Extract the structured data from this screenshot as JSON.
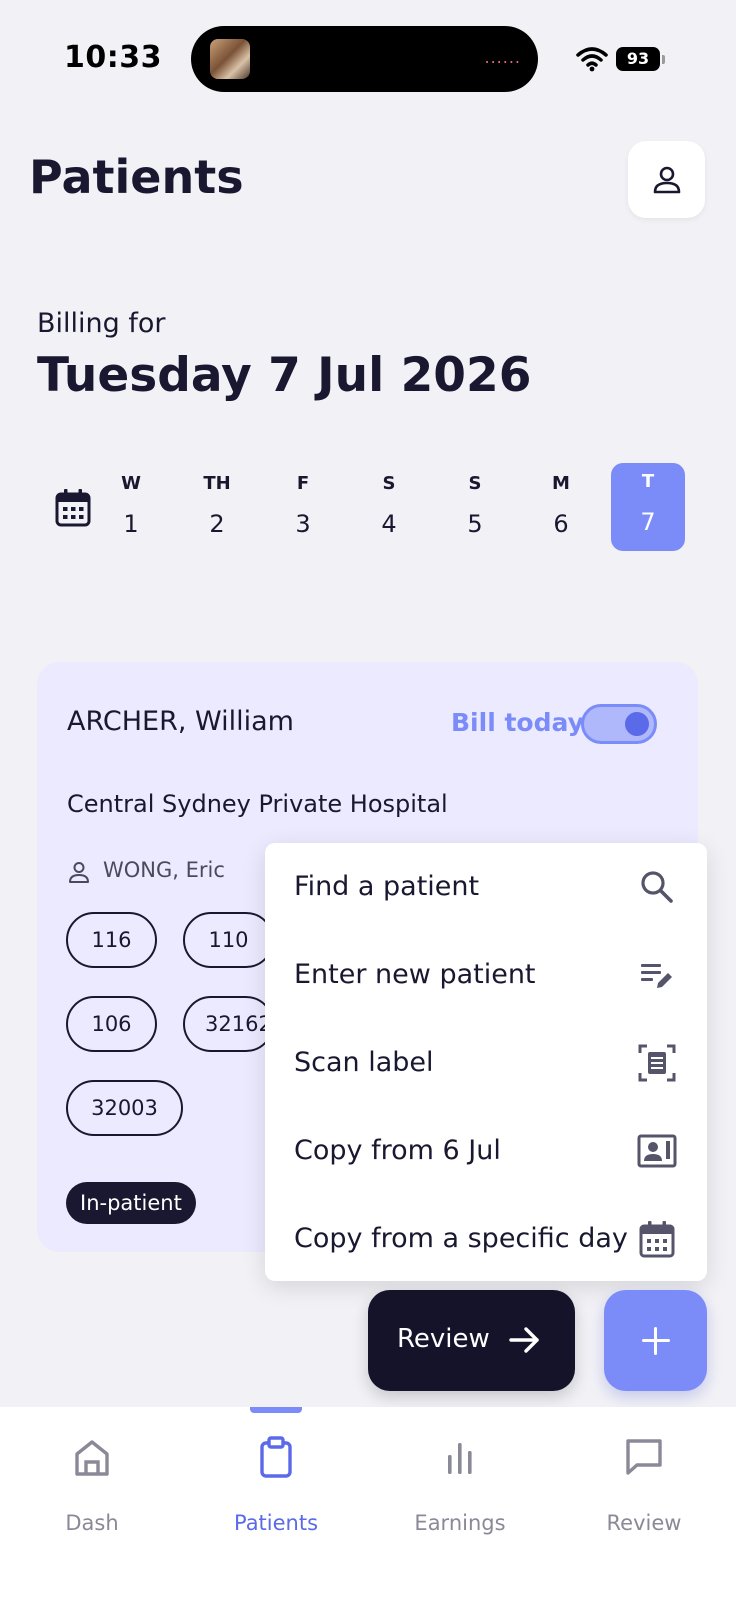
{
  "status_bar": {
    "time": "10:33",
    "battery": "93",
    "activity_dots": "......"
  },
  "header": {
    "title": "Patients",
    "profile_icon": "person-icon"
  },
  "billing": {
    "label": "Billing for",
    "date": "Tuesday 7 Jul 2026"
  },
  "day_strip": {
    "calendar_icon": "calendar-icon",
    "days": [
      {
        "dow": "W",
        "num": "1",
        "selected": false
      },
      {
        "dow": "TH",
        "num": "2",
        "selected": false
      },
      {
        "dow": "F",
        "num": "3",
        "selected": false
      },
      {
        "dow": "S",
        "num": "4",
        "selected": false
      },
      {
        "dow": "S",
        "num": "5",
        "selected": false
      },
      {
        "dow": "M",
        "num": "6",
        "selected": false
      },
      {
        "dow": "T",
        "num": "7",
        "selected": true
      }
    ]
  },
  "patient_card": {
    "name": "ARCHER, William",
    "bill_today_label": "Bill today",
    "bill_today_on": true,
    "hospital": "Central Sydney Private Hospital",
    "doctor": "WONG, Eric",
    "codes": [
      "116",
      "110",
      "106",
      "32162",
      "32003"
    ],
    "admission_type": "In-patient"
  },
  "menu": {
    "items": [
      {
        "label": "Find a patient",
        "icon": "search-icon"
      },
      {
        "label": "Enter new patient",
        "icon": "edit-list-icon"
      },
      {
        "label": "Scan label",
        "icon": "scan-document-icon"
      },
      {
        "label": "Copy from 6 Jul",
        "icon": "contact-card-icon"
      },
      {
        "label": "Copy from a specific day",
        "icon": "calendar-icon"
      }
    ]
  },
  "actions": {
    "review_label": "Review",
    "review_icon": "arrow-right-icon",
    "add_icon": "plus-icon"
  },
  "bottom_nav": {
    "items": [
      {
        "label": "Dash",
        "icon": "home-icon",
        "active": false
      },
      {
        "label": "Patients",
        "icon": "clipboard-icon",
        "active": true
      },
      {
        "label": "Earnings",
        "icon": "bar-chart-icon",
        "active": false
      },
      {
        "label": "Review",
        "icon": "chat-icon",
        "active": false
      }
    ]
  },
  "colors": {
    "accent": "#7b8cf8",
    "dark": "#1a1830",
    "card_bg": "#ebeaff",
    "page_bg": "#f2f2f6"
  }
}
